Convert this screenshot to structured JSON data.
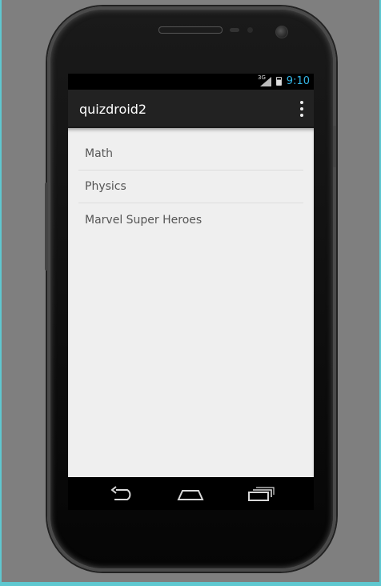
{
  "status_bar": {
    "network": "3G",
    "time": "9:10",
    "accent": "#33b5e5"
  },
  "action_bar": {
    "title": "quizdroid2",
    "menu_icon": "overflow-menu-icon"
  },
  "topics": [
    {
      "label": "Math"
    },
    {
      "label": "Physics"
    },
    {
      "label": "Marvel Super Heroes"
    }
  ],
  "nav_bar": {
    "icons": [
      "back-icon",
      "home-icon",
      "recent-apps-icon"
    ]
  }
}
